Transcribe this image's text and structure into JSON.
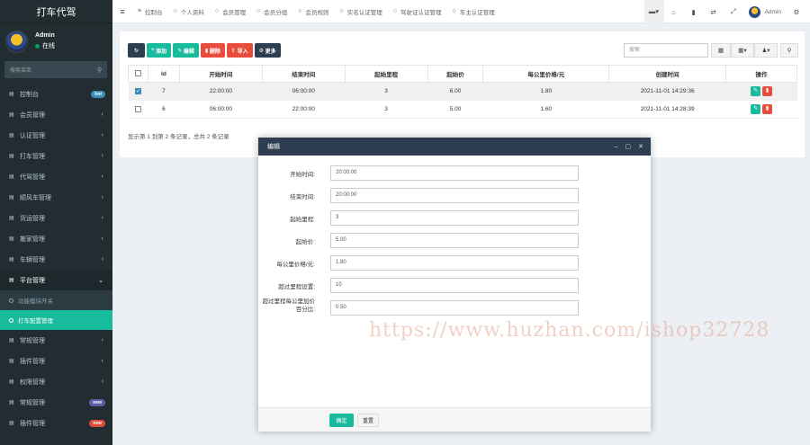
{
  "app": {
    "brand": "打车代驾"
  },
  "user": {
    "name": "Admin",
    "status": "在线"
  },
  "sidebar": {
    "search_placeholder": "搜索菜单",
    "items": [
      {
        "label": "控制台",
        "badge": "hot"
      },
      {
        "label": "会员管理"
      },
      {
        "label": "认证管理"
      },
      {
        "label": "打车管理"
      },
      {
        "label": "代驾管理"
      },
      {
        "label": "顺风车管理"
      },
      {
        "label": "货运管理"
      },
      {
        "label": "搬家管理"
      },
      {
        "label": "车辆管理"
      },
      {
        "label": "平台管理"
      }
    ],
    "submenu": [
      {
        "label": "功能模块开关"
      },
      {
        "label": "打车配置管理"
      }
    ],
    "items_after": [
      {
        "label": "常规管理"
      },
      {
        "label": "插件管理"
      },
      {
        "label": "权限管理"
      },
      {
        "label": "常规管理",
        "badge": "new"
      },
      {
        "label": "插件管理",
        "badge": "new"
      }
    ]
  },
  "topnav": {
    "tabs": [
      {
        "icon": "menu-icon",
        "label": "控制台"
      },
      {
        "icon": "circle-icon",
        "label": "个人资料"
      },
      {
        "icon": "circle-icon",
        "label": "会员管理"
      },
      {
        "icon": "circle-icon",
        "label": "会员分组"
      },
      {
        "icon": "circle-icon",
        "label": "会员规则"
      },
      {
        "icon": "circle-icon",
        "label": "实名认证管理"
      },
      {
        "icon": "circle-icon",
        "label": "驾驶证认证管理"
      },
      {
        "icon": "circle-icon",
        "label": "车主认证管理"
      }
    ],
    "user_name": "Admin"
  },
  "toolbar": {
    "add": "添加",
    "edit": "编辑",
    "delete": "删除",
    "import": "导入",
    "more": "更多",
    "search_placeholder": "搜索"
  },
  "table": {
    "headers": [
      "Id",
      "开始时间",
      "结束时间",
      "起始里程",
      "起始价",
      "每公里价格/元",
      "创建时间",
      "操作"
    ],
    "rows": [
      {
        "checked": true,
        "cells": [
          "7",
          "22:00:00",
          "06:00:00",
          "3",
          "6.00",
          "1.80",
          "2021-11-01 14:29:36"
        ]
      },
      {
        "checked": false,
        "cells": [
          "6",
          "06:00:00",
          "22:00:00",
          "3",
          "5.00",
          "1.60",
          "2021-11-01 14:28:39"
        ]
      }
    ],
    "pager_info": "显示第 1 到第 2 条记录，总共 2 条记录"
  },
  "modal": {
    "title": "编辑",
    "fields": [
      {
        "label": "开始时间:",
        "value": "20:00:00"
      },
      {
        "label": "结束时间:",
        "value": "20:00:00"
      },
      {
        "label": "起始里程:",
        "value": "3"
      },
      {
        "label": "起始价:",
        "value": "5.00"
      },
      {
        "label": "每公里价格/元:",
        "value": "1.80"
      },
      {
        "label": "超过里程设置:",
        "value": "10"
      },
      {
        "label": "超过里程每公里加价百分比:",
        "value": "0.50"
      }
    ],
    "ok": "确定",
    "reset": "重置"
  },
  "watermark": "https://www.huzhan.com/ishop32728"
}
